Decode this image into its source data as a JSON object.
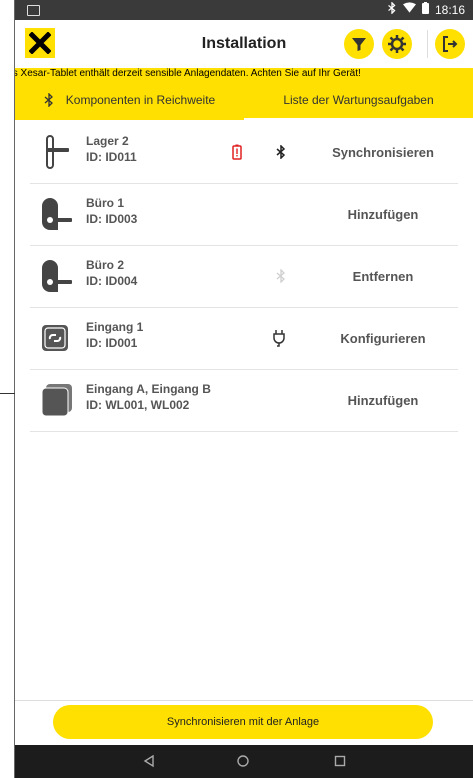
{
  "status_bar": {
    "time": "18:16",
    "icons": [
      "bluetooth-icon",
      "wifi-icon",
      "battery-icon"
    ]
  },
  "app_bar": {
    "title": "Installation",
    "logo_text": "X",
    "buttons": [
      "filter-icon",
      "settings-gear-icon",
      "logout-icon"
    ]
  },
  "warning": {
    "text": "Das Xesar-Tablet enthält derzeit sensible Anlagendaten. Achten Sie auf Ihr Gerät!"
  },
  "tabs": [
    {
      "label": "Komponenten in Reichweite",
      "icon": "bluetooth-icon",
      "active": false
    },
    {
      "label": "Liste der Wartungsaufgaben",
      "active": true
    }
  ],
  "items": [
    {
      "name": "Lager 2",
      "id": "ID: ID011",
      "type": "handle",
      "status": [
        "battery-warning-icon",
        "bluetooth-icon"
      ],
      "action": "Synchronisieren"
    },
    {
      "name": "Büro 1",
      "id": "ID: ID003",
      "type": "escutcheon",
      "status": [],
      "action": "Hinzufügen"
    },
    {
      "name": "Büro 2",
      "id": "ID: ID004",
      "type": "escutcheon",
      "status": [
        "bluetooth-faded-icon"
      ],
      "action": "Entfernen"
    },
    {
      "name": "Eingang 1",
      "id": "ID: ID001",
      "type": "online",
      "status": [
        "power-plug-icon"
      ],
      "action": "Konfigurieren"
    },
    {
      "name": "Eingang A, Eingang B",
      "id": "ID: WL001, WL002",
      "type": "wall-reader",
      "status": [],
      "action": "Hinzufügen"
    }
  ],
  "sync_button": {
    "label": "Synchronisieren mit der Anlage"
  },
  "nav": [
    "back-icon",
    "home-icon",
    "recents-icon"
  ],
  "colors": {
    "accent": "#ffe000",
    "warning_red": "#e02020"
  }
}
